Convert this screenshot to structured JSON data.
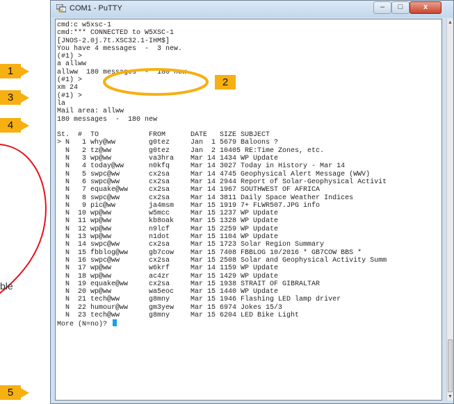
{
  "window": {
    "title": "COM1 - PuTTY",
    "minimize_glyph": "–",
    "maximize_glyph": "□",
    "close_glyph": "x"
  },
  "terminal": {
    "lines": [
      "cmd:c w5xsc-1",
      "cmd:*** CONNECTED to W5XSC-1",
      "[JNOS-2.0j.7t.XSC32.1-IHM$]",
      "You have 4 messages  -  3 new.",
      "(#1) >",
      "a allww",
      "allww  180 messages  -  180 new.",
      "(#1) >",
      "xm 24",
      "(#1) >",
      "la",
      "Mail area: allww",
      "180 messages  -  180 new",
      "",
      "St.  #  TO            FROM      DATE   SIZE SUBJECT",
      "> N   1 why@ww        g0tez     Jan  1 5679 Baloons ?",
      "  N   2 tz@ww         g0tez     Jan  2 10405 RE:Time Zones, etc.",
      "  N   3 wp@ww         va3hra    Mar 14 1434 WP Update",
      "  N   4 today@ww      n0kfq     Mar 14 3027 Today in History - Mar 14",
      "  N   5 swpc@ww       cx2sa     Mar 14 4745 Geophysical Alert Message (WWV)",
      "  N   6 swpc@ww       cx2sa     Mar 14 2944 Report of Solar-Geophysical Activit",
      "  N   7 equake@ww     cx2sa     Mar 14 1967 SOUTHWEST OF AFRICA",
      "  N   8 swpc@ww       cx2sa     Mar 14 3811 Daily Space Weather Indices",
      "  N   9 pic@ww        ja4msm    Mar 15 1919 7+ FLWR507.JPG info",
      "  N  10 wp@ww         w5mcc     Mar 15 1237 WP Update",
      "  N  11 wp@ww         kb8oak    Mar 15 1328 WP Update",
      "  N  12 wp@ww         n9lcf     Mar 15 2259 WP Update",
      "  N  13 wp@ww         n1dot     Mar 15 1104 WP Update",
      "  N  14 swpc@ww       cx2sa     Mar 15 1723 Solar Region Summary",
      "  N  15 fbblog@ww     gb7cow    Mar 15 7408 FBBLOG 10/2016 * GB7COW BBS *",
      "  N  16 swpc@ww       cx2sa     Mar 15 2508 Solar and Geophysical Activity Summ",
      "  N  17 wp@ww         w6krf     Mar 14 1159 WP Update",
      "  N  18 wp@ww         ac4zr     Mar 15 1429 WP Update",
      "  N  19 equake@ww     cx2sa     Mar 15 1938 STRAIT OF GIBRALTAR",
      "  N  20 wp@ww         wa5eoc    Mar 15 1440 WP Update",
      "  N  21 tech@ww       g8mny     Mar 15 1946 Flashing LED lamp driver",
      "  N  22 humour@ww     gm3yew    Mar 15 6974 Jokes 15/3",
      "  N  23 tech@ww       g8mny     Mar 15 6204 LED Bike Light",
      "More (N=no)? "
    ]
  },
  "callouts": {
    "c1": "1",
    "c2": "2",
    "c3": "3",
    "c4": "4",
    "c5": "5"
  },
  "side_note": "ble",
  "colors": {
    "callout": "#f6b012",
    "ring": "#f6b012",
    "red_outline": "#e8101a",
    "cursor": "#1aa0e8"
  }
}
